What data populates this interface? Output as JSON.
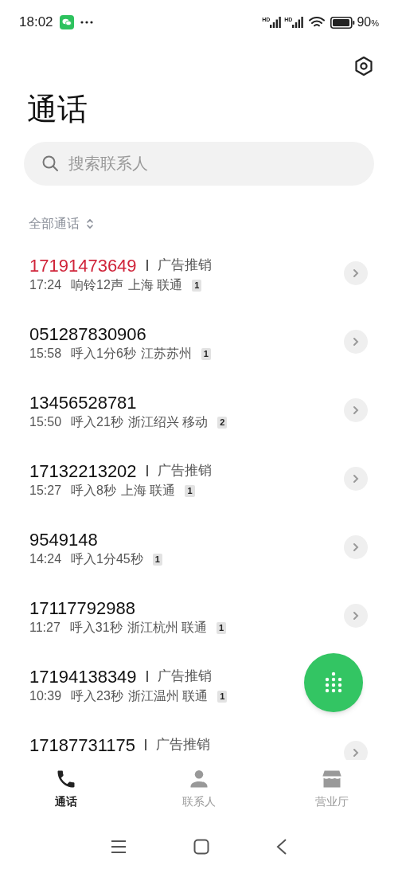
{
  "status_bar": {
    "time": "18:02",
    "battery": "90",
    "battery_unit": "%",
    "signal_labels": [
      "HD",
      "HD"
    ]
  },
  "title": "通话",
  "search": {
    "placeholder": "搜索联系人"
  },
  "filter": {
    "label": "全部通话"
  },
  "calls": [
    {
      "number": "17191473649",
      "missed": true,
      "tag": "广告推销",
      "time": "17:24",
      "detail": "响铃12声",
      "location": "上海 联通",
      "count": "1"
    },
    {
      "number": "051287830906",
      "missed": false,
      "time": "15:58",
      "detail": "呼入1分6秒",
      "location": "江苏苏州",
      "count": "1"
    },
    {
      "number": "13456528781",
      "missed": false,
      "time": "15:50",
      "detail": "呼入21秒",
      "location": "浙江绍兴 移动",
      "count": "2"
    },
    {
      "number": "17132213202",
      "missed": false,
      "tag": "广告推销",
      "time": "15:27",
      "detail": "呼入8秒",
      "location": "上海 联通",
      "count": "1"
    },
    {
      "number": "9549148",
      "missed": false,
      "time": "14:24",
      "detail": "呼入1分45秒",
      "count": "1"
    },
    {
      "number": "17117792988",
      "missed": false,
      "time": "11:27",
      "detail": "呼入31秒",
      "location": "浙江杭州 联通",
      "count": "1"
    },
    {
      "number": "17194138349",
      "missed": false,
      "tag": "广告推销",
      "time": "10:39",
      "detail": "呼入23秒",
      "location": "浙江温州 联通",
      "count": "1",
      "button_covered": true
    },
    {
      "number": "17187731175",
      "missed": false,
      "tag": "广告推销"
    }
  ],
  "bottom_tabs": [
    {
      "label": "通话",
      "kind": "phone",
      "selected": true
    },
    {
      "label": "联系人",
      "kind": "person",
      "selected": false
    },
    {
      "label": "营业厅",
      "kind": "store",
      "selected": false
    }
  ]
}
